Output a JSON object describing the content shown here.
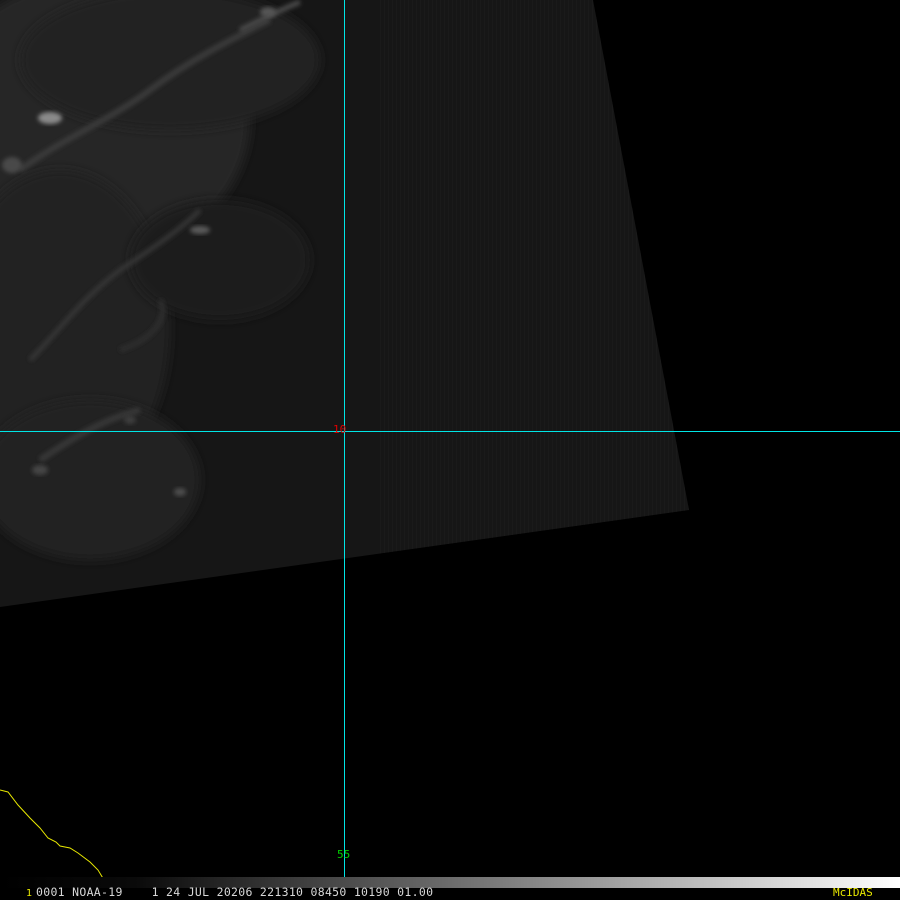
{
  "colors": {
    "background": "#000000",
    "graticule": "#00e5e5",
    "coastline": "#e8e800",
    "lat_label": "#e00000",
    "lon_label": "#00d000",
    "text": "#d8d8d8",
    "brand": "#e8e800",
    "swath": "#161616"
  },
  "graticule": {
    "latitude_label": "10",
    "longitude_label": "55"
  },
  "status_bar": {
    "frame_number": "1",
    "image_info": "0001 NOAA-19    1 24 JUL 20206 221310 08450 10190 01.00",
    "brand": "McIDAS"
  }
}
